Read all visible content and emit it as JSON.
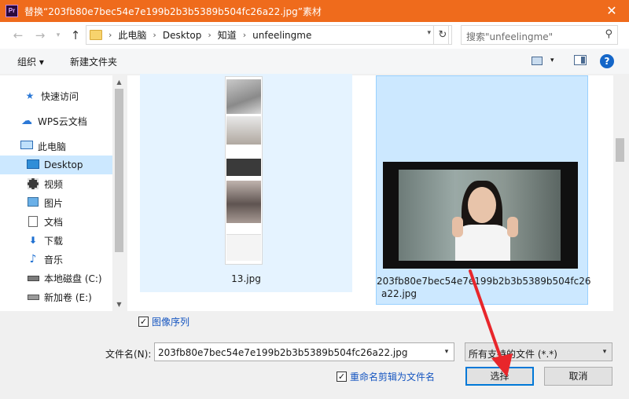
{
  "window": {
    "app_icon_text": "Pr",
    "title": "替换“203fb80e7bec54e7e199b2b3b5389b504fc26a22.jpg”素材",
    "close_glyph": "✕"
  },
  "address": {
    "breadcrumbs": [
      "此电脑",
      "Desktop",
      "知道",
      "unfeelingme"
    ],
    "search_placeholder": "搜索\"unfeelingme\""
  },
  "toolbar": {
    "organize_label": "组织 ▾",
    "new_folder_label": "新建文件夹"
  },
  "nav": {
    "items": [
      {
        "label": "快速访问",
        "icon": "star-icon"
      },
      {
        "label": "WPS云文档",
        "icon": "cloud-icon"
      },
      {
        "label": "此电脑",
        "icon": "computer-icon"
      },
      {
        "label": "Desktop",
        "icon": "desktop-icon"
      },
      {
        "label": "视频",
        "icon": "video-icon"
      },
      {
        "label": "图片",
        "icon": "pictures-icon"
      },
      {
        "label": "文档",
        "icon": "documents-icon"
      },
      {
        "label": "下载",
        "icon": "download-icon"
      },
      {
        "label": "音乐",
        "icon": "music-icon"
      },
      {
        "label": "本地磁盘 (C:)",
        "icon": "drive-icon"
      },
      {
        "label": "新加卷 (E:)",
        "icon": "drive-icon"
      }
    ]
  },
  "files": [
    {
      "name": "13.jpg"
    },
    {
      "name_line1": "203fb80e7bec54e7e199b2b3b5389b504fc26",
      "name_line2": "a22.jpg"
    }
  ],
  "options": {
    "image_sequence_label": "图像序列",
    "rename_clip_label": "重命名剪辑为文件名"
  },
  "filename": {
    "label": "文件名(N):",
    "value": "203fb80e7bec54e7e199b2b3b5389b504fc26a22.jpg"
  },
  "filetype": {
    "value": "所有支持的文件 (*.*)"
  },
  "buttons": {
    "select_label": "选择",
    "cancel_label": "取消"
  },
  "colors": {
    "titlebar": "#ef6b1c",
    "selection": "#cce8ff",
    "accent": "#0078d7",
    "annotation_arrow": "#e8262b"
  }
}
